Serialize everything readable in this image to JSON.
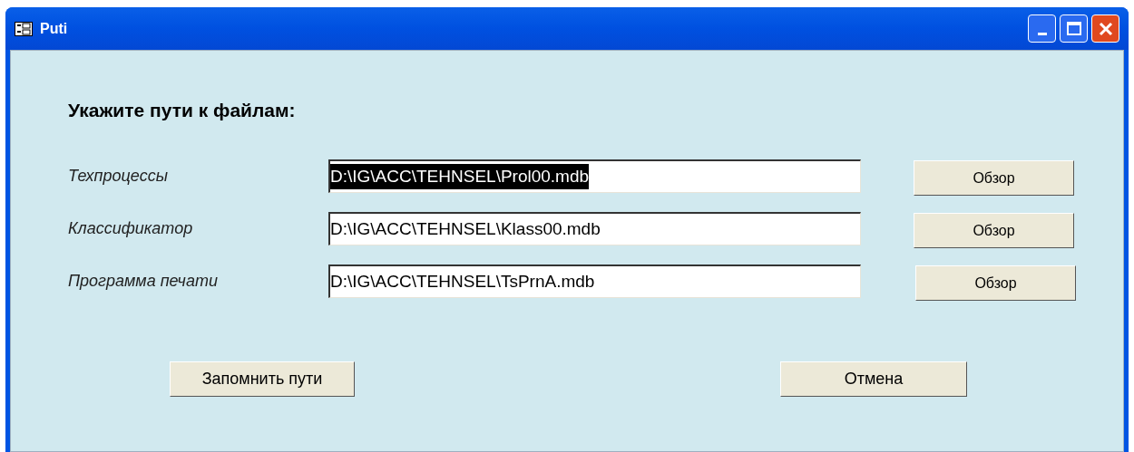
{
  "window": {
    "title": "Puti"
  },
  "heading": "Укажите пути к файлам:",
  "rows": [
    {
      "label": "Техпроцессы",
      "value": "D:\\IG\\ACC\\TEHNSEL\\Prol00.mdb",
      "text_selected": true,
      "button": "Обзор"
    },
    {
      "label": "Классификатор",
      "value": "D:\\IG\\ACC\\TEHNSEL\\Klass00.mdb",
      "text_selected": false,
      "button": "Обзор"
    },
    {
      "label": "Программа печати",
      "value": "D:\\IG\\ACC\\TEHNSEL\\TsPrnA.mdb",
      "text_selected": false,
      "button": "Обзор"
    }
  ],
  "buttons": [
    "Запомнить пути",
    "Отмена"
  ]
}
